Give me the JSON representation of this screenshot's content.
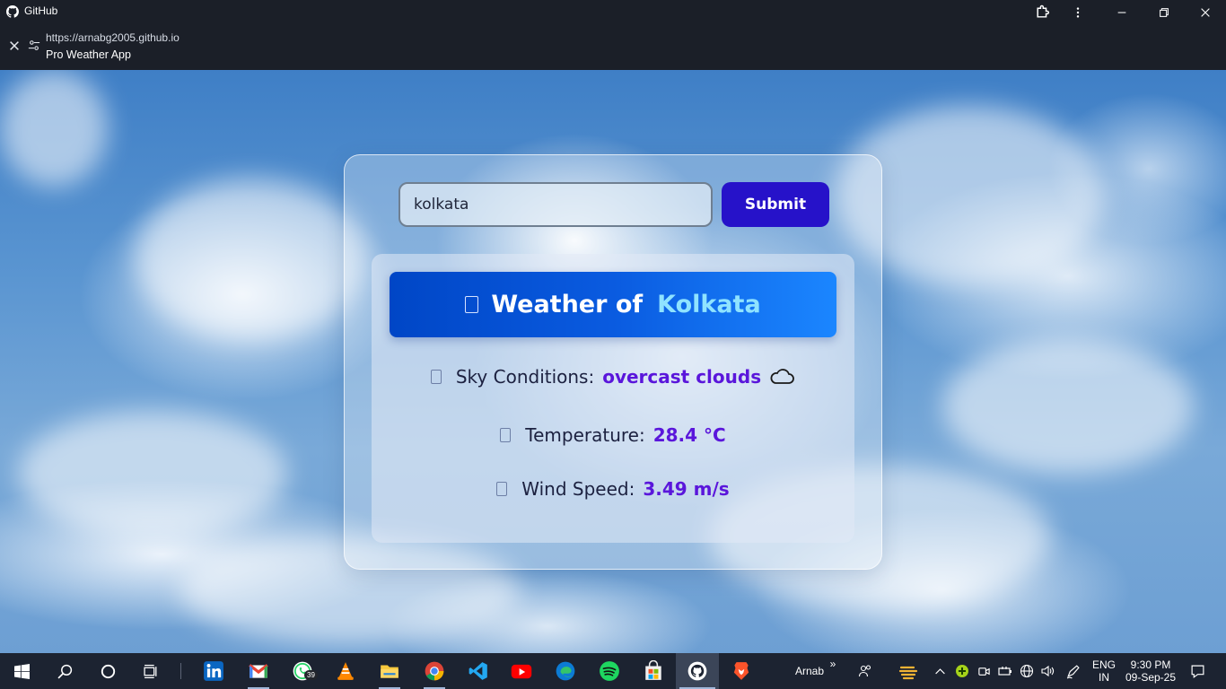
{
  "window": {
    "app_title": "GitHub"
  },
  "address_bar": {
    "url": "https://arnabg2005.github.io",
    "page_title": "Pro Weather App"
  },
  "weather_app": {
    "search": {
      "value": "kolkata",
      "submit_label": "Submit"
    },
    "banner": {
      "label": "Weather of",
      "city": "Kolkata"
    },
    "rows": [
      {
        "label": "Sky Conditions:",
        "value": "overcast clouds",
        "icon": "cloud-icon"
      },
      {
        "label": "Temperature:",
        "value": "28.4 °C"
      },
      {
        "label": "Wind Speed:",
        "value": "3.49 m/s"
      }
    ],
    "colors": {
      "submit_bg": "#2612c9",
      "banner_start": "#0046c6",
      "banner_end": "#1b86ff",
      "banner_city": "#8fe3ff",
      "value_text": "#5a16db"
    }
  },
  "taskbar": {
    "apps": [
      {
        "name": "linkedin-icon"
      },
      {
        "name": "mail-icon"
      },
      {
        "name": "whatsapp-icon",
        "badge": "39"
      },
      {
        "name": "vlc-icon"
      },
      {
        "name": "file-explorer-icon"
      },
      {
        "name": "chrome-icon"
      },
      {
        "name": "vscode-icon"
      },
      {
        "name": "youtube-icon"
      },
      {
        "name": "edge-icon"
      },
      {
        "name": "spotify-icon"
      },
      {
        "name": "microsoft-store-icon"
      },
      {
        "name": "github-app-icon"
      },
      {
        "name": "brave-icon"
      }
    ],
    "user_label": "Arnab",
    "chevron": "»",
    "language": "ENG",
    "region": "IN",
    "time": "9:30 PM",
    "date": "09-Sep-25"
  }
}
